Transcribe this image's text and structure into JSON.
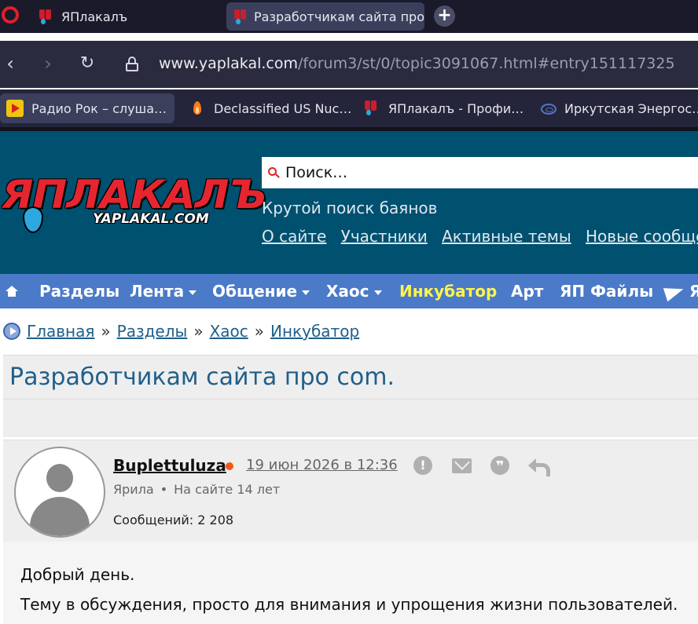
{
  "browser": {
    "tabs": [
      {
        "label": "ЯПлакалъ"
      },
      {
        "label": "Разработчикам сайта про"
      }
    ],
    "new_tab_symbol": "+",
    "url_host": "www.yaplakal.com",
    "url_path": "/forum3/st/0/topic3091067.html#entry151117325",
    "nav_icons": {
      "back": "‹",
      "forward": "›",
      "reload": "↻"
    },
    "bookmarks": [
      {
        "label": "Радио Рок – слуша…",
        "icon": "radio-rock-icon"
      },
      {
        "label": "Declassified US Nuc…",
        "icon": "flame-icon"
      },
      {
        "label": "ЯПлакалъ - Профи…",
        "icon": "yaplakal-icon"
      },
      {
        "label": "Иркутская Энергос…",
        "icon": "globe-icon"
      }
    ]
  },
  "site": {
    "logo_text": "ЯПЛАКАЛЪ",
    "logo_sub": "YAPLAKAL.COM",
    "search_placeholder": "Поиск…",
    "search_sub": "Крутой поиск баянов",
    "header_links": [
      "О сайте",
      "Участники",
      "Активные темы",
      "Новые сообще"
    ],
    "nav": [
      {
        "label": "Разделы"
      },
      {
        "label": "Лента"
      },
      {
        "label": "Общение"
      },
      {
        "label": "Хаос"
      },
      {
        "label": "Инкубатор"
      },
      {
        "label": "Арт"
      },
      {
        "label": "ЯП Файлы"
      },
      {
        "label": "Я"
      }
    ]
  },
  "breadcrumb": {
    "items": [
      "Главная",
      "Разделы",
      "Хаос",
      "Инкубатор"
    ],
    "separator": "»"
  },
  "topic": {
    "title": "Разработчикам сайта про com."
  },
  "post": {
    "username": "Buplettuluza",
    "date": "19 июн 2026 в 12:36",
    "rank": "Ярила",
    "meta_dot": "•",
    "on_site": "На сайте 14 лет",
    "posts_count": "Сообщений: 2 208",
    "report_symbol": "!",
    "quote_symbol": "❞",
    "lines": [
      "Добрый день.",
      "Тему в обсуждения, просто для внимания и упрощения жизни пользователей."
    ]
  },
  "colors": {
    "header_bg": "#005070",
    "nav_bg": "#4a7ac8",
    "nav_highlight": "#fff44a",
    "link": "#1f5f8a",
    "logo_red": "#e52630",
    "online": "#f05a1a"
  }
}
